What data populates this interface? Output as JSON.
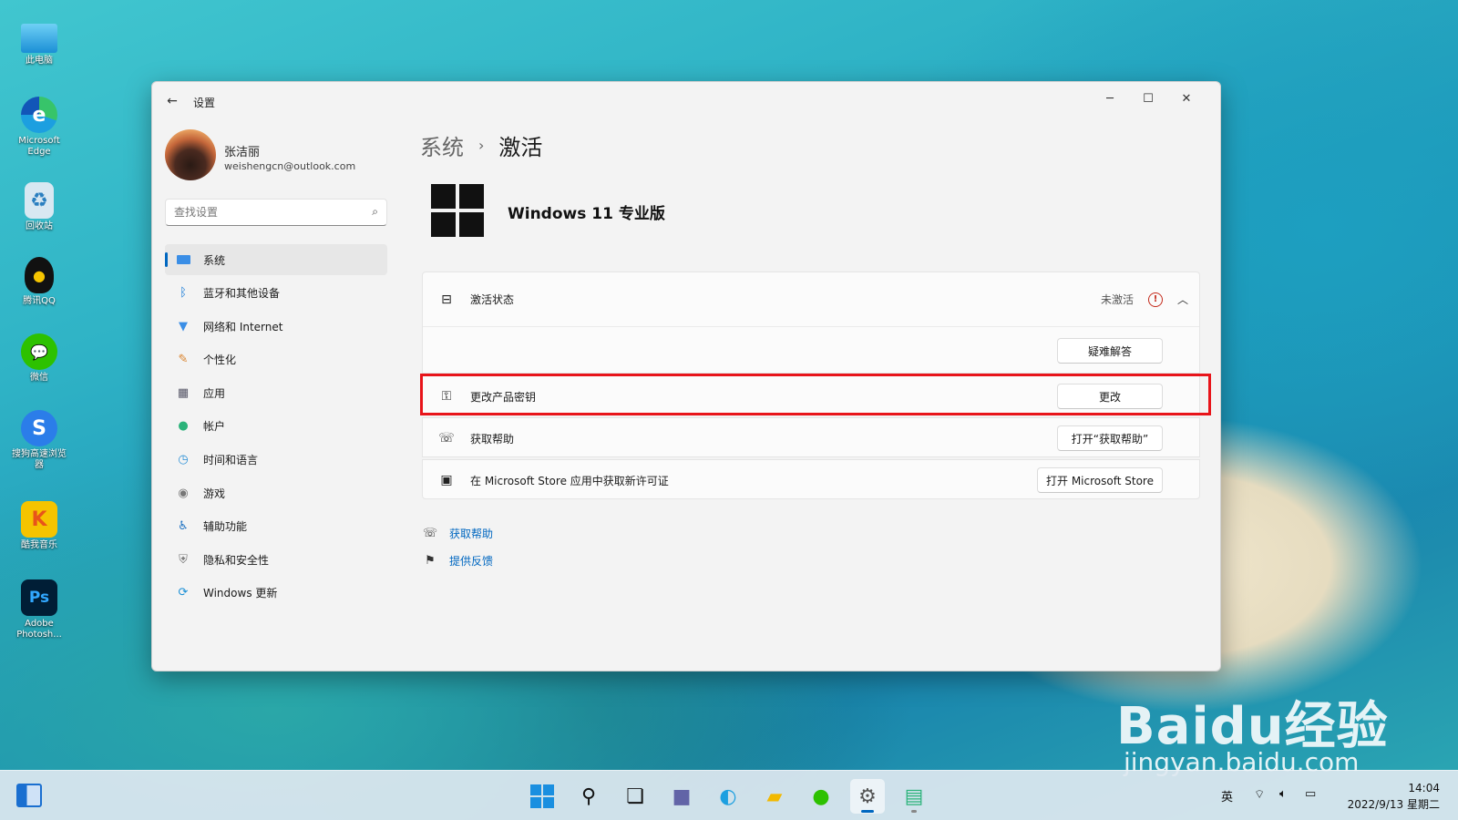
{
  "desktop": {
    "icons": [
      {
        "label": "此电脑",
        "icon": "monitor-icon"
      },
      {
        "label": "Microsoft Edge",
        "icon": "edge-icon"
      },
      {
        "label": "回收站",
        "icon": "recycle-bin-icon"
      },
      {
        "label": "腾讯QQ",
        "icon": "qq-icon"
      },
      {
        "label": "微信",
        "icon": "wechat-icon"
      },
      {
        "label": "搜狗高速浏览器",
        "icon": "sogou-browser-icon"
      },
      {
        "label": "酷我音乐",
        "icon": "kuwo-music-icon"
      },
      {
        "label": "Adobe Photosh...",
        "icon": "photoshop-icon"
      }
    ]
  },
  "window": {
    "title": "设置",
    "controls": {
      "minimize": "─",
      "maximize": "☐",
      "close": "✕"
    }
  },
  "profile": {
    "name": "张洁丽",
    "email": "weishengcn@outlook.com"
  },
  "search": {
    "placeholder": "查找设置"
  },
  "nav": {
    "items": [
      {
        "label": "系统",
        "icon": "system-icon",
        "active": true
      },
      {
        "label": "蓝牙和其他设备",
        "icon": "bluetooth-icon"
      },
      {
        "label": "网络和 Internet",
        "icon": "network-icon"
      },
      {
        "label": "个性化",
        "icon": "personalization-icon"
      },
      {
        "label": "应用",
        "icon": "apps-icon"
      },
      {
        "label": "帐户",
        "icon": "account-icon"
      },
      {
        "label": "时间和语言",
        "icon": "time-language-icon"
      },
      {
        "label": "游戏",
        "icon": "gaming-icon"
      },
      {
        "label": "辅助功能",
        "icon": "accessibility-icon"
      },
      {
        "label": "隐私和安全性",
        "icon": "privacy-icon"
      },
      {
        "label": "Windows 更新",
        "icon": "windows-update-icon"
      }
    ]
  },
  "main": {
    "breadcrumb": {
      "parent": "系统",
      "separator": "›",
      "current": "激活"
    },
    "edition": "Windows 11 专业版",
    "activation": {
      "label": "激活状态",
      "status": "未激活",
      "troubleshoot_button": "疑难解答"
    },
    "rows": [
      {
        "label": "更改产品密钥",
        "button": "更改",
        "icon": "key-icon"
      },
      {
        "label": "获取帮助",
        "button": "打开“获取帮助”",
        "icon": "get-help-icon"
      },
      {
        "label": "在 Microsoft Store 应用中获取新许可证",
        "button": "打开 Microsoft Store",
        "icon": "store-icon"
      }
    ],
    "links": [
      {
        "label": "获取帮助",
        "icon": "help-icon"
      },
      {
        "label": "提供反馈",
        "icon": "feedback-icon"
      }
    ]
  },
  "taskbar": {
    "apps": [
      "start-icon",
      "search-icon",
      "task-view-icon",
      "teams-chat-icon",
      "edge-icon",
      "file-explorer-icon",
      "wechat-icon",
      "settings-icon",
      "paint-icon"
    ],
    "ime": "英",
    "time": "14:04",
    "date": "2022/9/13 星期二"
  },
  "watermark": {
    "main": "Baidu经验",
    "sub": "jingyan.baidu.com"
  },
  "colors": {
    "accent": "#0067c0",
    "highlight_box": "#e8141a",
    "warning": "#c42b1c"
  }
}
